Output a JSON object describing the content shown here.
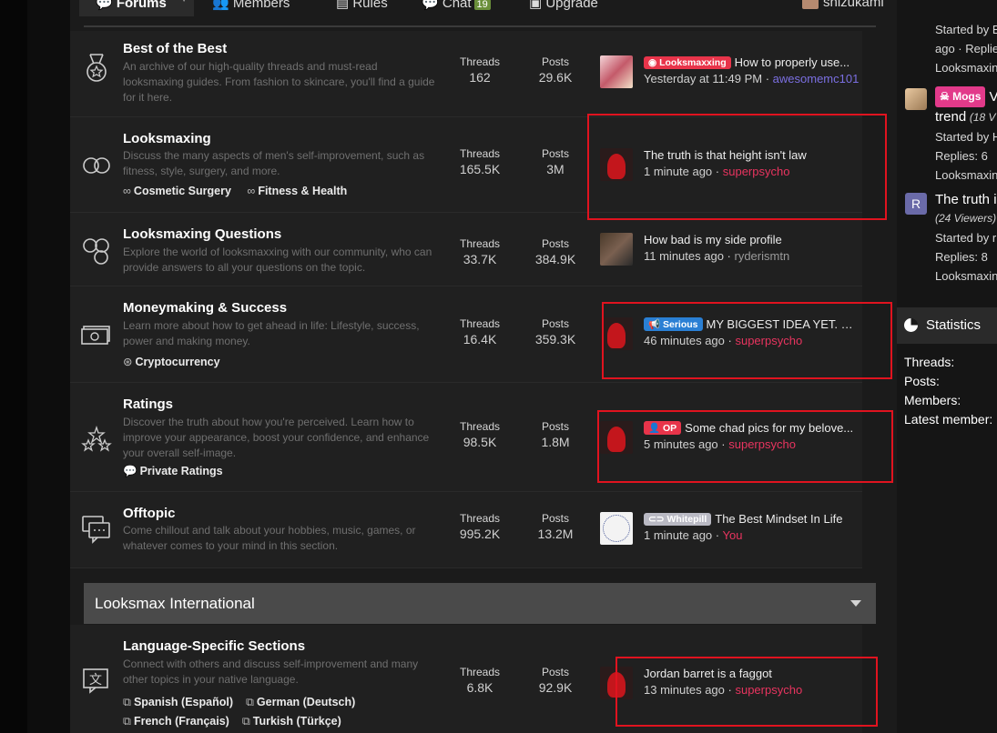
{
  "nav": {
    "tabs": [
      {
        "label": "Forums"
      },
      {
        "label": "Members"
      },
      {
        "label": "Rules"
      },
      {
        "label": "Chat",
        "badge": "19"
      },
      {
        "label": "Upgrade"
      }
    ],
    "username": "shizukami"
  },
  "forums": [
    {
      "title": "Best of the Best",
      "desc": "An archive of our high-quality threads and must-read looksmaxing guides. From fashion to skincare, you'll find a guide for it here.",
      "threads_label": "Threads",
      "threads": "162",
      "posts_label": "Posts",
      "posts": "29.6K",
      "last": {
        "prefix": "Looksmaxxing",
        "title": "How to properly use...",
        "time": "Yesterday at 11:49 PM",
        "user": "awesomemc101"
      }
    },
    {
      "title": "Looksmaxing",
      "desc": "Discuss the many aspects of men's self-improvement, such as fitness, style, surgery, and more.",
      "subforums": [
        "Cosmetic Surgery",
        "Fitness & Health"
      ],
      "threads_label": "Threads",
      "threads": "165.5K",
      "posts_label": "Posts",
      "posts": "3M",
      "last": {
        "title": "The truth is that height isn't law",
        "time": "1 minute ago",
        "user": "superpsycho"
      }
    },
    {
      "title": "Looksmaxing Questions",
      "desc": "Explore the world of looksmaxxing with our community, who can provide answers to all your questions on the topic.",
      "threads_label": "Threads",
      "threads": "33.7K",
      "posts_label": "Posts",
      "posts": "384.9K",
      "last": {
        "title": "How bad is my side profile",
        "time": "11 minutes ago",
        "user": "ryderismtn"
      }
    },
    {
      "title": "Moneymaking & Success",
      "desc": "Learn more about how to get ahead in life: Lifestyle, success, power and making money.",
      "subforums": [
        "Cryptocurrency"
      ],
      "threads_label": "Threads",
      "threads": "16.4K",
      "posts_label": "Posts",
      "posts": "359.3K",
      "last": {
        "prefix": "Serious",
        "title": "MY BIGGEST IDEA YET. DE...",
        "time": "46 minutes ago",
        "user": "superpsycho"
      }
    },
    {
      "title": "Ratings",
      "desc": "Discover the truth about how you're perceived. Learn how to improve your appearance, boost your confidence, and enhance your overall self-image.",
      "subforums": [
        "Private Ratings"
      ],
      "threads_label": "Threads",
      "threads": "98.5K",
      "posts_label": "Posts",
      "posts": "1.8M",
      "last": {
        "prefix": "OP",
        "title": "Some chad pics for my belove...",
        "time": "5 minutes ago",
        "user": "superpsycho"
      }
    },
    {
      "title": "Offtopic",
      "desc": "Come chillout and talk about your hobbies, music, games, or whatever comes to your mind in this section.",
      "threads_label": "Threads",
      "threads": "995.2K",
      "posts_label": "Posts",
      "posts": "13.2M",
      "last": {
        "prefix": "Whitepill",
        "title": "The Best Mindset In Life",
        "time": "1 minute ago",
        "user": "You"
      }
    }
  ],
  "category2": {
    "title": "Looksmax International",
    "forum": {
      "title": "Language-Specific Sections",
      "desc": "Connect with others and discuss self-improvement and many other topics in your native language.",
      "subforums": [
        "Spanish (Español)",
        "German (Deutsch)",
        "French (Français)",
        "Turkish (Türkçe)"
      ],
      "threads_label": "Threads",
      "threads": "6.8K",
      "posts_label": "Posts",
      "posts": "92.9K",
      "last": {
        "title": "Jordan barret is a faggot",
        "time": "13 minutes ago",
        "user": "superpsycho"
      }
    }
  },
  "sidebar": {
    "item1": {
      "line1": "Started by B",
      "line2": "ago · Replie",
      "line3": "Looksmaxin"
    },
    "item2": {
      "prefix": "Mogs",
      "title_end": "V",
      "line1": "trend",
      "viewers": "(18 V",
      "line2": "Started by H",
      "line3": "Replies: 6",
      "line4": "Looksmaxin"
    },
    "item3": {
      "initial": "R",
      "title": "The truth i",
      "viewers": "(24 Viewers)",
      "line2": "Started by r",
      "line3": "Replies: 8",
      "line4": "Looksmaxin"
    },
    "statistics": {
      "title": "Statistics",
      "rows": [
        "Threads:",
        "Posts:",
        "Members:",
        "Latest member:"
      ]
    }
  },
  "colors": {
    "accent_red": "#e8345f",
    "highlight_box": "#e0131f",
    "prefix_looksmaxxing": "#e8344a",
    "prefix_serious": "#2a7fd4",
    "prefix_op": "#e8344a",
    "prefix_whitepill": "#b9b9c3",
    "prefix_mogs": "#e23a8a"
  }
}
